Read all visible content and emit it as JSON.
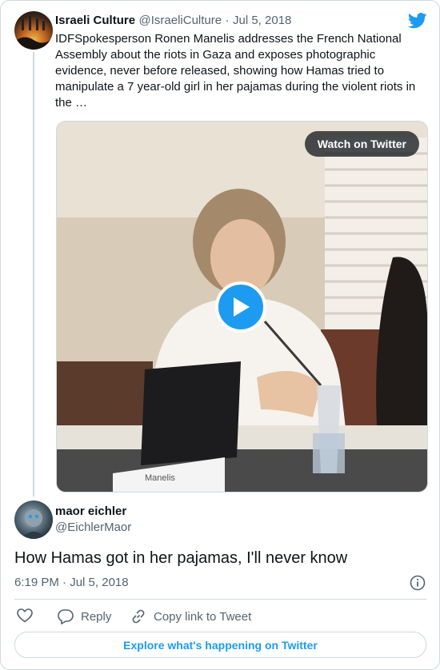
{
  "quoted_tweet": {
    "author_name": "Israeli Culture",
    "author_handle": "@IsraeliCulture",
    "separator": "·",
    "date": "Jul 5, 2018",
    "text": "IDFSpokesperson Ronen Manelis addresses the French National Assembly about the riots in Gaza and exposes photographic evidence, never before released, showing how Hamas tried to manipulate a 7 year-old girl in her pajamas during the violent riots in the …",
    "media": {
      "watch_label": "Watch on Twitter",
      "nameplate_text": "Manelis"
    }
  },
  "reply_tweet": {
    "author_name": "maor eichler",
    "author_handle": "@EichlerMaor",
    "text": "How Hamas got in her pajamas, I'll never know",
    "time": "6:19 PM",
    "separator": "·",
    "date": "Jul 5, 2018"
  },
  "actions": {
    "reply_label": "Reply",
    "copy_link_label": "Copy link to Tweet"
  },
  "footer": {
    "explore_label": "Explore what's happening on Twitter"
  },
  "colors": {
    "accent": "#1d9bf0",
    "text": "#0f1419",
    "muted": "#536471",
    "border": "#cfd9de"
  }
}
